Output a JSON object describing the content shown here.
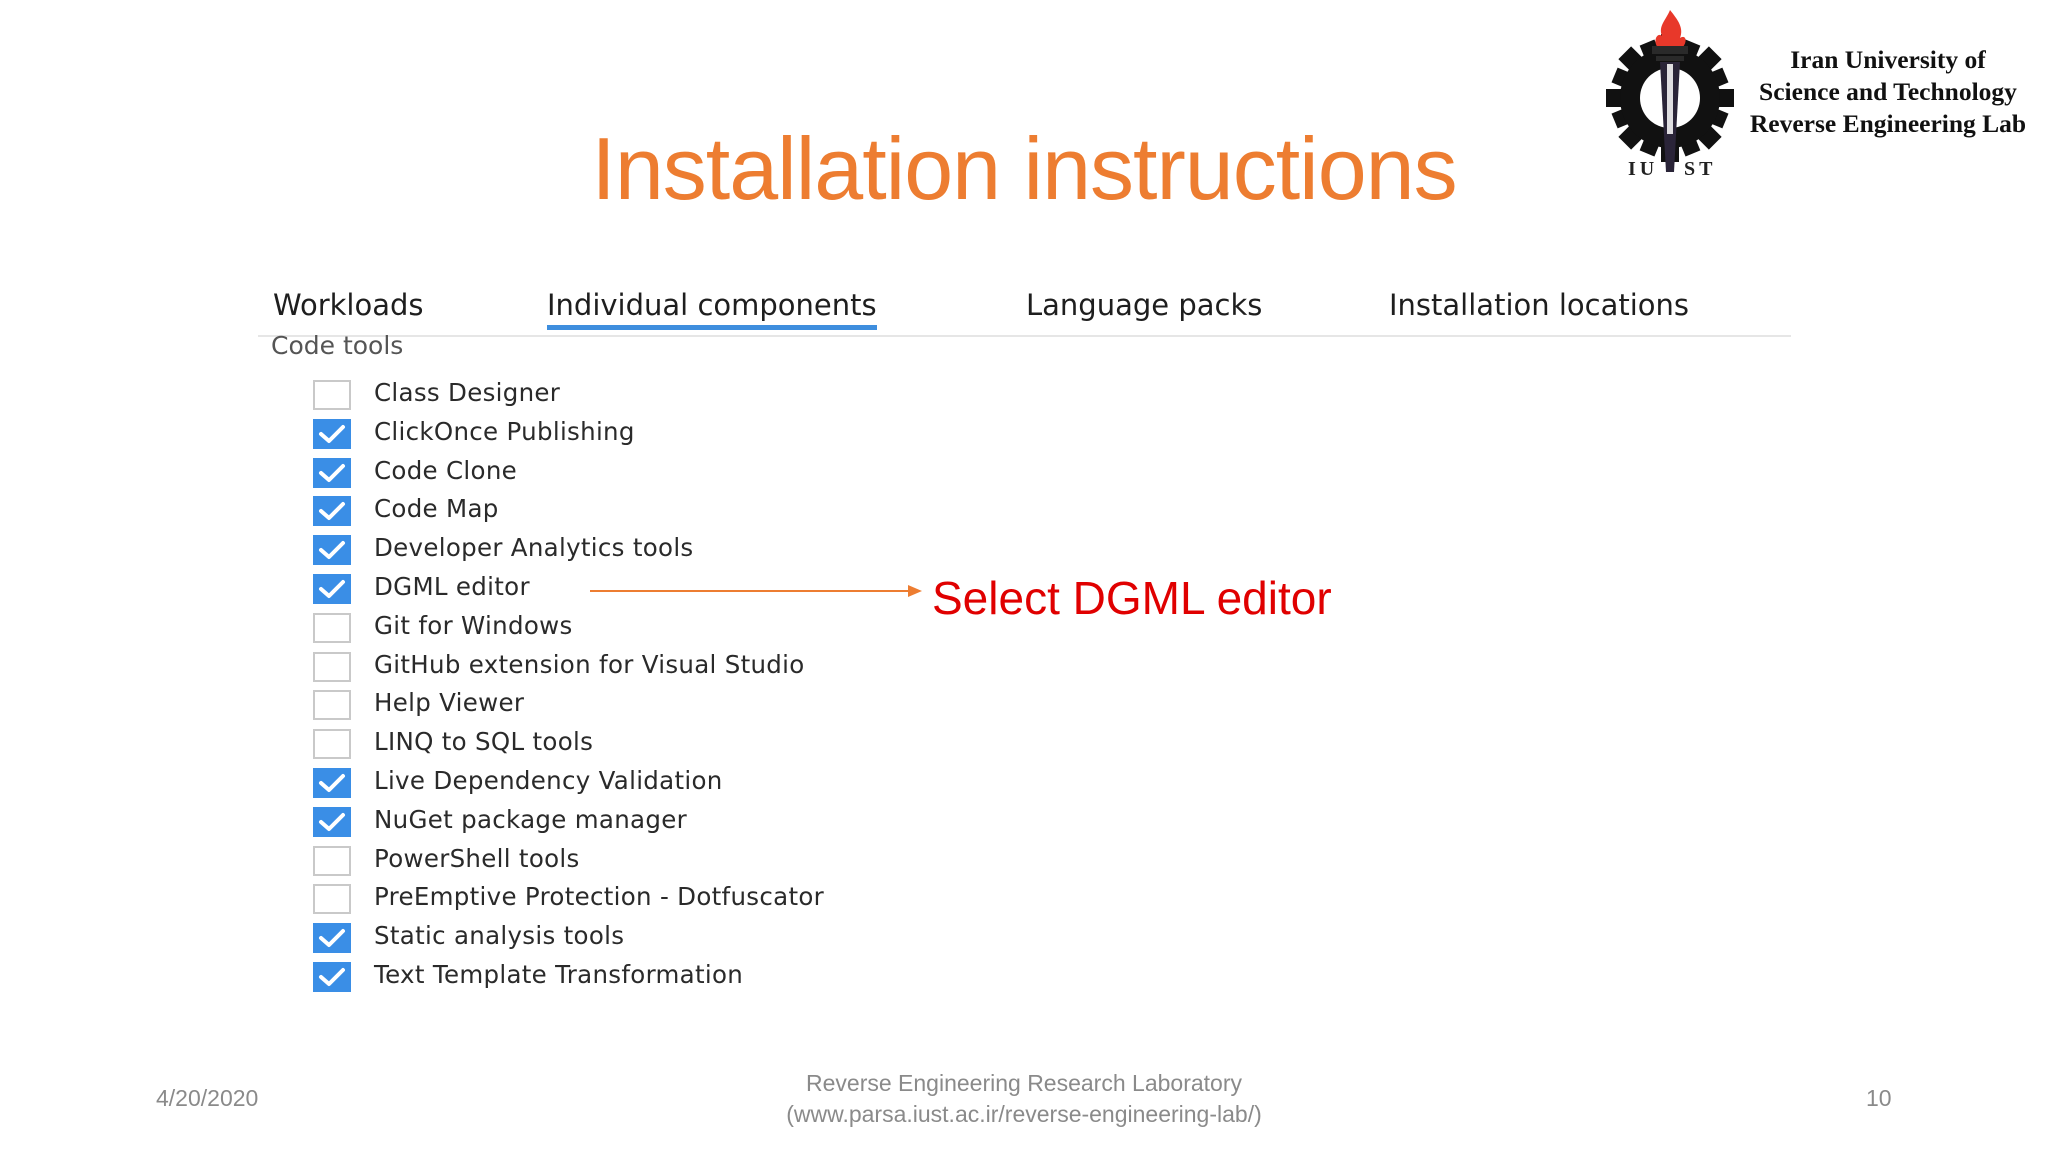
{
  "slide": {
    "title": "Installation instructions",
    "annotation": "Select DGML editor",
    "footer": {
      "date": "4/20/2020",
      "lab": "Reverse Engineering Research Laboratory",
      "url": "(www.parsa.iust.ac.ir/reverse-engineering-lab/)",
      "page": "10"
    },
    "colors": {
      "title": "#ED7D31",
      "annotation": "#E00000",
      "accent": "#3A8EE6"
    }
  },
  "logo": {
    "lines": [
      "Iran University of",
      "Science and Technology",
      "Reverse Engineering Lab"
    ],
    "mark_left": "IU",
    "mark_right": "ST"
  },
  "installer": {
    "tabs": [
      {
        "label": "Workloads",
        "active": false
      },
      {
        "label": "Individual components",
        "active": true
      },
      {
        "label": "Language packs",
        "active": false
      },
      {
        "label": "Installation locations",
        "active": false
      }
    ],
    "section": "Code tools",
    "components": [
      {
        "label": "Class Designer",
        "checked": false
      },
      {
        "label": "ClickOnce Publishing",
        "checked": true
      },
      {
        "label": "Code Clone",
        "checked": true
      },
      {
        "label": "Code Map",
        "checked": true
      },
      {
        "label": "Developer Analytics tools",
        "checked": true
      },
      {
        "label": "DGML editor",
        "checked": true
      },
      {
        "label": "Git for Windows",
        "checked": false
      },
      {
        "label": "GitHub extension for Visual Studio",
        "checked": false
      },
      {
        "label": "Help Viewer",
        "checked": false
      },
      {
        "label": "LINQ to SQL tools",
        "checked": false
      },
      {
        "label": "Live Dependency Validation",
        "checked": true
      },
      {
        "label": "NuGet package manager",
        "checked": true
      },
      {
        "label": "PowerShell tools",
        "checked": false
      },
      {
        "label": "PreEmptive Protection - Dotfuscator",
        "checked": false
      },
      {
        "label": "Static analysis tools",
        "checked": true
      },
      {
        "label": "Text Template Transformation",
        "checked": true
      }
    ]
  }
}
